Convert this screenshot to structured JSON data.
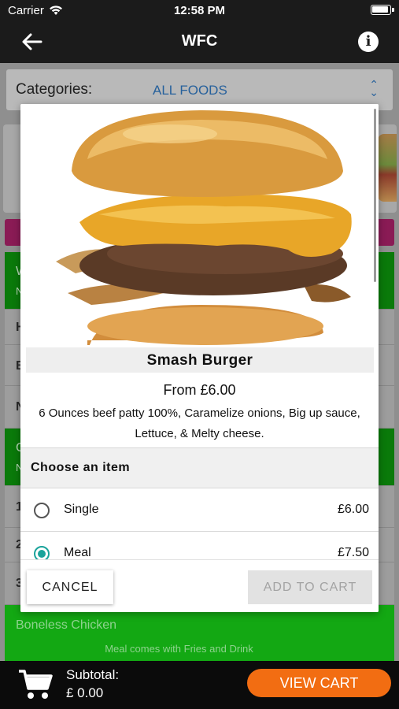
{
  "status_bar": {
    "carrier": "Carrier",
    "time": "12:58 PM"
  },
  "nav": {
    "title": "WFC",
    "back_icon": "arrow-left-icon",
    "info_icon": "info-icon"
  },
  "categories": {
    "label": "Categories:",
    "selected": "ALL FOODS"
  },
  "background_rows": [
    {
      "text": "W"
    },
    {
      "text": "N"
    },
    {
      "text": "H"
    },
    {
      "text": "B"
    },
    {
      "text": "N"
    },
    {
      "text": "C"
    },
    {
      "text": "N"
    },
    {
      "text": "1"
    },
    {
      "text": "2"
    },
    {
      "text": "3"
    }
  ],
  "boneless": {
    "name": "Boneless Chicken",
    "desc": "Meal comes with Fries and Drink"
  },
  "modal": {
    "product_name": "Smash Burger",
    "price_from": "From £6.00",
    "description": "6 Ounces beef patty 100%, Caramelize onions, Big up sauce, Lettuce, & Melty cheese.",
    "choose_label": "Choose an item",
    "options": [
      {
        "label": "Single",
        "price": "£6.00",
        "selected": false
      },
      {
        "label": "Meal",
        "price": "£7.50",
        "selected": true
      }
    ],
    "cancel_label": "CANCEL",
    "add_label": "ADD TO CART",
    "accent_color": "#1aa39b"
  },
  "bottom_bar": {
    "subtotal_label": "Subtotal:",
    "subtotal_value": "£ 0.00",
    "view_cart_label": "VIEW CART",
    "view_cart_color": "#f26d12"
  }
}
